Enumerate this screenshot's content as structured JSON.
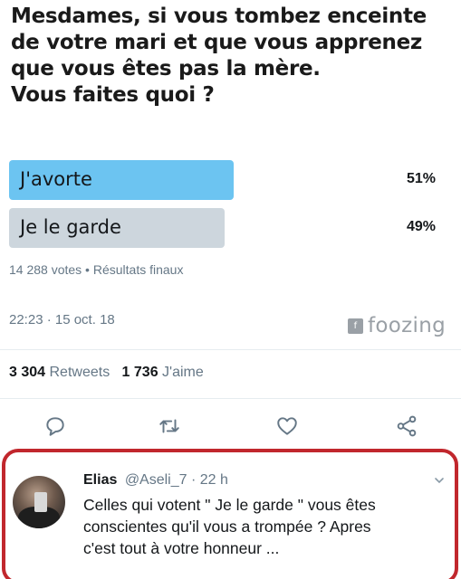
{
  "tweet": {
    "question_lines": [
      "Mesdames, si vous tombez enceinte",
      "de votre mari et que vous apprenez",
      "que vous êtes pas la mère.",
      "Vous faites quoi ?"
    ]
  },
  "poll": {
    "options": [
      {
        "label": "J'avorte",
        "percent": "51%",
        "value": 51,
        "leading": true
      },
      {
        "label": "Je le garde",
        "percent": "49%",
        "value": 49,
        "leading": false
      }
    ],
    "summary": "14 288 votes • Résultats finaux"
  },
  "meta": {
    "timestamp": "22:23 · 15 oct. 18",
    "watermark": "foozing"
  },
  "stats": {
    "retweets_count": "3 304",
    "retweets_label": "Retweets",
    "likes_count": "1 736",
    "likes_label": "J'aime"
  },
  "actions": [
    "reply-icon",
    "retweet-icon",
    "like-icon",
    "share-icon"
  ],
  "reply": {
    "name": "Elias",
    "handle": "@Aseli_7 · 22 h",
    "text_lines": [
      "Celles qui votent \" Je le garde \" vous êtes",
      "conscientes qu'il vous a trompée ? Apres",
      "c'est tout à votre honneur ..."
    ]
  },
  "colors": {
    "leading_bar": "#6cc4f1",
    "other_bar": "#cdd6dd",
    "highlight_border": "#c1272d",
    "secondary_text": "#657786"
  }
}
